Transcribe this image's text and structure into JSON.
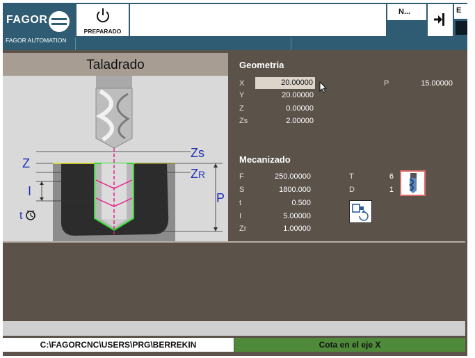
{
  "header": {
    "brand": "FAGOR",
    "brand_subtitle": "FAGOR AUTOMATION",
    "status_label": "PREPARADO",
    "message": "",
    "n_label": "N...",
    "e_label": "E"
  },
  "cycle": {
    "title": "Taladrado"
  },
  "diagram": {
    "zs_label": "Zs",
    "z_label": "Z",
    "zr_label": "ZR",
    "i_label": "I",
    "p_label": "P",
    "t_label": "t"
  },
  "geometry": {
    "title": "Geometria",
    "x_label": "X",
    "x_value": "20.00000",
    "y_label": "Y",
    "y_value": "20.00000",
    "z_label": "Z",
    "z_value": "0.00000",
    "zs_label": "Zs",
    "zs_value": "2.00000",
    "p_label": "P",
    "p_value": "15.00000"
  },
  "machining": {
    "title": "Mecanizado",
    "f_label": "F",
    "f_value": "250.00000",
    "s_label": "S",
    "s_value": "1800.000",
    "t_label": "t",
    "t_value": "0.500",
    "i_label": "I",
    "i_value": "5.00000",
    "zr_label": "Zr",
    "zr_value": "1.00000",
    "tool_label": "T",
    "tool_value": "6",
    "d_label": "D",
    "d_value": "1"
  },
  "footer": {
    "path": "C:\\FAGORCNC\\USERS\\PRG\\BERREKIN",
    "status": "Cota en el eje X"
  },
  "colors": {
    "header_blue": "#2f5c73",
    "panel_brown": "#5b5249",
    "title_tan": "#a79d92",
    "footer_green": "#4e8a3a",
    "drill_outline_green": "#33dd33",
    "axis_magenta": "#e8208a",
    "dimension_blue": "#1f2fb8"
  },
  "icons": [
    "fagor-logo-icon",
    "power-icon",
    "exit-arrow-icon",
    "drill-bit-icon",
    "spindle-rotation-icon",
    "timer-icon",
    "mouse-cursor-icon"
  ]
}
